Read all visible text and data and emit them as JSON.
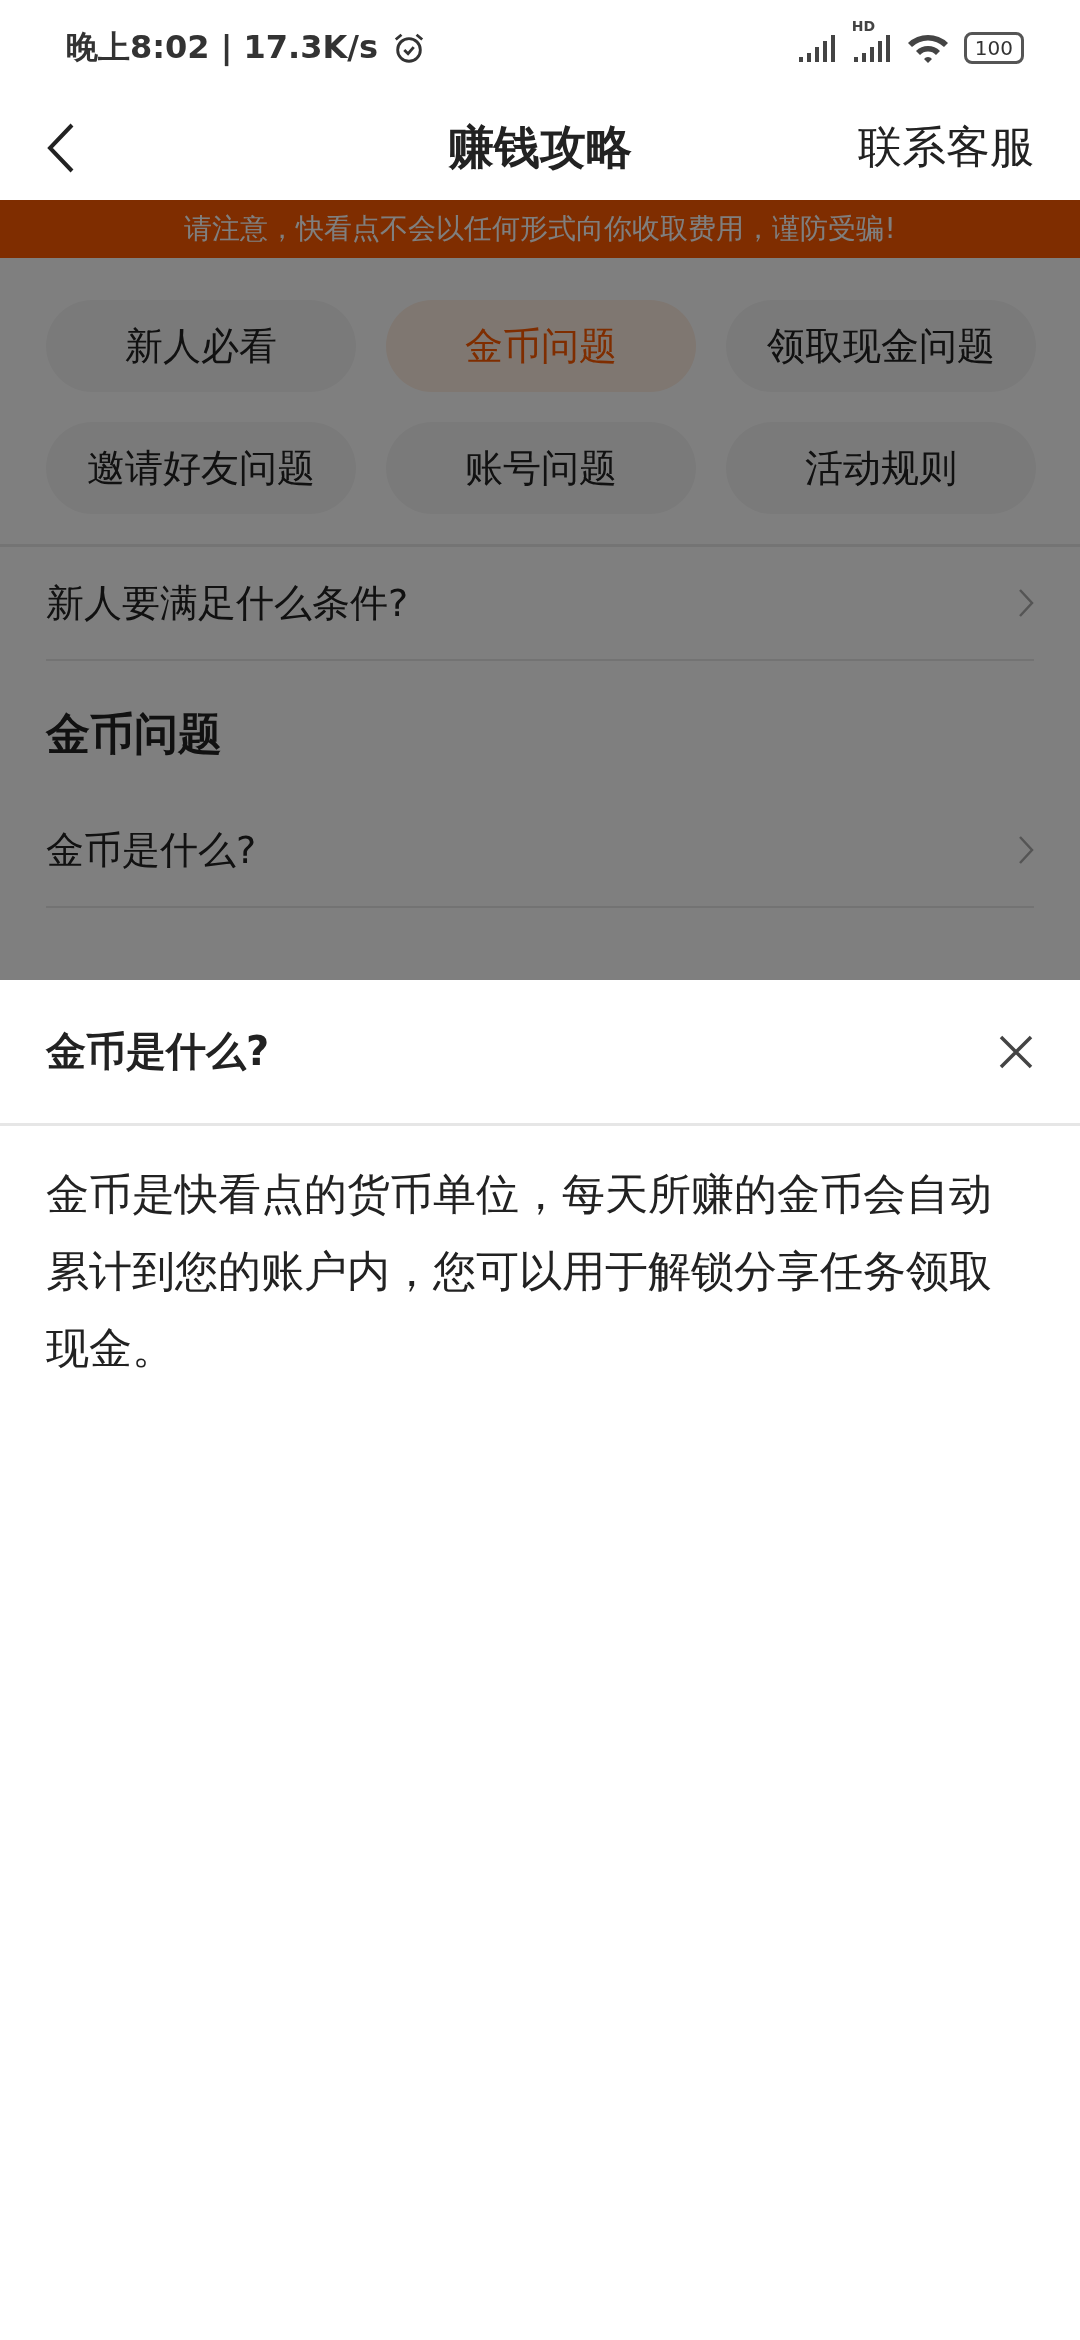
{
  "status_bar": {
    "time": "晚上8:02 | 17.3K/s",
    "network_label": "HD",
    "battery": "100"
  },
  "nav": {
    "title": "赚钱攻略",
    "action": "联系客服"
  },
  "notice": "请注意，快看点不会以任何形式向你收取费用，谨防受骗!",
  "categories": [
    {
      "label": "新人必看",
      "selected": false
    },
    {
      "label": "金币问题",
      "selected": true
    },
    {
      "label": "领取现金问题",
      "selected": false
    },
    {
      "label": "邀请好友问题",
      "selected": false
    },
    {
      "label": "账号问题",
      "selected": false
    },
    {
      "label": "活动规则",
      "selected": false
    }
  ],
  "faq_groups": [
    {
      "items": [
        "新人要满足什么条件?"
      ]
    },
    {
      "title": "金币问题",
      "items": [
        "金币是什么?"
      ]
    }
  ],
  "sheet": {
    "title": "金币是什么?",
    "body": "金币是快看点的货币单位，每天所赚的金币会自动累计到您的账户内，您可以用于解锁分享任务领取现金。"
  }
}
